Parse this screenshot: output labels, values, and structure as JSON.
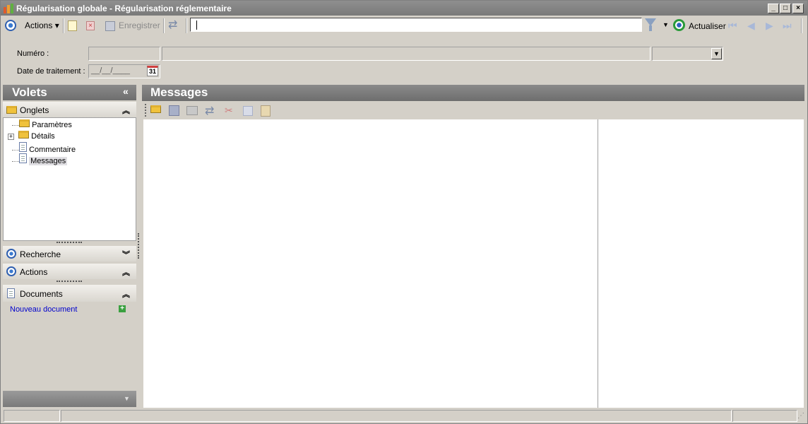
{
  "window": {
    "title": "Régularisation globale - Régularisation réglementaire",
    "minimize": "_",
    "maximize": "□",
    "close": "×"
  },
  "toolbar": {
    "actions_label": "Actions",
    "save_label": "Enregistrer",
    "refresh_label": "Actualiser",
    "filter_value": ""
  },
  "form": {
    "numero_label": "Numéro :",
    "date_label": "Date de traitement :",
    "date_placeholder": "__/__/____",
    "calendar_day": "31"
  },
  "left_panel": {
    "title": "Volets",
    "collapse_glyph": "«",
    "onglets": {
      "label": "Onglets",
      "items": [
        {
          "label": "Paramètres",
          "icon": "folder-icon"
        },
        {
          "label": "Détails",
          "icon": "folder-icon",
          "expander": "+"
        },
        {
          "label": "Commentaire",
          "icon": "document-icon"
        },
        {
          "label": "Messages",
          "icon": "document-icon",
          "selected": true
        }
      ]
    },
    "recherche": {
      "label": "Recherche"
    },
    "actions": {
      "label": "Actions"
    },
    "documents": {
      "label": "Documents",
      "new_doc": "Nouveau document"
    }
  },
  "main_panel": {
    "title": "Messages"
  },
  "colors": {
    "header_gray": "#7a7a7a",
    "link_blue": "#0000cc",
    "selection": "#e0dfe3"
  }
}
